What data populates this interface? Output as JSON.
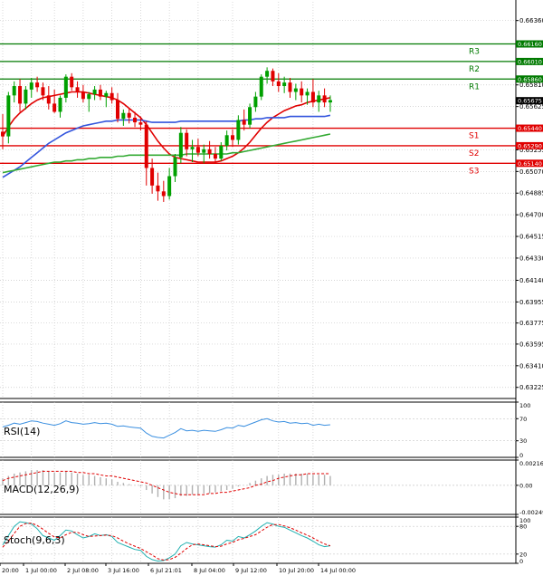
{
  "chart_data": {
    "type": "candlestick",
    "price_axis": {
      "range": [
        0.6313,
        0.6652
      ],
      "tick_values": [
        0.6636,
        0.6581,
        0.65625,
        0.65255,
        0.6507,
        0.64885,
        0.647,
        0.64515,
        0.6433,
        0.6414,
        0.63955,
        0.63775,
        0.63595,
        0.6341,
        0.63225
      ],
      "tick_labels": [
        "0.66360",
        "0.65810",
        "0.65625",
        "0.65255",
        "0.65070",
        "0.64885",
        "0.64700",
        "0.64515",
        "0.64330",
        "0.64140",
        "0.63955",
        "0.63775",
        "0.63595",
        "0.63410",
        "0.63225"
      ],
      "current_price": 0.65675,
      "current_price_label": "0.65675"
    },
    "levels": [
      {
        "name": "R3",
        "value": 0.6616,
        "label": "0.66160",
        "color": "#007a00"
      },
      {
        "name": "R2",
        "value": 0.6601,
        "label": "0.66010",
        "color": "#007a00"
      },
      {
        "name": "R1",
        "value": 0.6586,
        "label": "0.65860",
        "color": "#007a00"
      },
      {
        "name": "S1",
        "value": 0.6544,
        "label": "0.65440",
        "color": "#e00000"
      },
      {
        "name": "S2",
        "value": 0.6529,
        "label": "0.65290",
        "color": "#e00000"
      },
      {
        "name": "S3",
        "value": 0.6514,
        "label": "0.65140",
        "color": "#e00000"
      }
    ],
    "candles": [
      {
        "o": 0.6541,
        "h": 0.6556,
        "l": 0.6526,
        "c": 0.6537
      },
      {
        "o": 0.6537,
        "h": 0.6575,
        "l": 0.6531,
        "c": 0.6572
      },
      {
        "o": 0.6572,
        "h": 0.6584,
        "l": 0.6566,
        "c": 0.658
      },
      {
        "o": 0.658,
        "h": 0.6586,
        "l": 0.6558,
        "c": 0.6565
      },
      {
        "o": 0.6565,
        "h": 0.658,
        "l": 0.656,
        "c": 0.6577
      },
      {
        "o": 0.6577,
        "h": 0.6587,
        "l": 0.657,
        "c": 0.6583
      },
      {
        "o": 0.6583,
        "h": 0.6588,
        "l": 0.6575,
        "c": 0.6579
      },
      {
        "o": 0.6579,
        "h": 0.6583,
        "l": 0.6568,
        "c": 0.6572
      },
      {
        "o": 0.6572,
        "h": 0.658,
        "l": 0.656,
        "c": 0.6565
      },
      {
        "o": 0.6565,
        "h": 0.6577,
        "l": 0.6557,
        "c": 0.6558
      },
      {
        "o": 0.6558,
        "h": 0.6572,
        "l": 0.6553,
        "c": 0.657
      },
      {
        "o": 0.657,
        "h": 0.659,
        "l": 0.6566,
        "c": 0.6588
      },
      {
        "o": 0.6588,
        "h": 0.6591,
        "l": 0.6576,
        "c": 0.6579
      },
      {
        "o": 0.6579,
        "h": 0.6584,
        "l": 0.657,
        "c": 0.6575
      },
      {
        "o": 0.6575,
        "h": 0.6581,
        "l": 0.6566,
        "c": 0.6569
      },
      {
        "o": 0.6569,
        "h": 0.6575,
        "l": 0.6558,
        "c": 0.6573
      },
      {
        "o": 0.6573,
        "h": 0.658,
        "l": 0.6568,
        "c": 0.6577
      },
      {
        "o": 0.6577,
        "h": 0.6581,
        "l": 0.6568,
        "c": 0.6571
      },
      {
        "o": 0.6571,
        "h": 0.6576,
        "l": 0.6562,
        "c": 0.6574
      },
      {
        "o": 0.6574,
        "h": 0.6579,
        "l": 0.6565,
        "c": 0.6568
      },
      {
        "o": 0.6568,
        "h": 0.6574,
        "l": 0.6549,
        "c": 0.6552
      },
      {
        "o": 0.6552,
        "h": 0.656,
        "l": 0.6546,
        "c": 0.6557
      },
      {
        "o": 0.6557,
        "h": 0.6561,
        "l": 0.6548,
        "c": 0.6553
      },
      {
        "o": 0.6553,
        "h": 0.6558,
        "l": 0.6545,
        "c": 0.6549
      },
      {
        "o": 0.6549,
        "h": 0.6554,
        "l": 0.6542,
        "c": 0.6547
      },
      {
        "o": 0.6547,
        "h": 0.655,
        "l": 0.6495,
        "c": 0.651
      },
      {
        "o": 0.651,
        "h": 0.6518,
        "l": 0.6488,
        "c": 0.6495
      },
      {
        "o": 0.6495,
        "h": 0.6506,
        "l": 0.6482,
        "c": 0.649
      },
      {
        "o": 0.649,
        "h": 0.6499,
        "l": 0.6481,
        "c": 0.6486
      },
      {
        "o": 0.6486,
        "h": 0.651,
        "l": 0.6483,
        "c": 0.6503
      },
      {
        "o": 0.6503,
        "h": 0.6522,
        "l": 0.6498,
        "c": 0.6519
      },
      {
        "o": 0.6519,
        "h": 0.6545,
        "l": 0.6514,
        "c": 0.654
      },
      {
        "o": 0.654,
        "h": 0.6543,
        "l": 0.652,
        "c": 0.6526
      },
      {
        "o": 0.6526,
        "h": 0.6534,
        "l": 0.6515,
        "c": 0.6528
      },
      {
        "o": 0.6528,
        "h": 0.6535,
        "l": 0.652,
        "c": 0.6523
      },
      {
        "o": 0.6523,
        "h": 0.653,
        "l": 0.6514,
        "c": 0.6526
      },
      {
        "o": 0.6526,
        "h": 0.6533,
        "l": 0.6518,
        "c": 0.6522
      },
      {
        "o": 0.6522,
        "h": 0.6528,
        "l": 0.6514,
        "c": 0.6518
      },
      {
        "o": 0.6518,
        "h": 0.6532,
        "l": 0.6516,
        "c": 0.6529
      },
      {
        "o": 0.6529,
        "h": 0.6542,
        "l": 0.6525,
        "c": 0.6538
      },
      {
        "o": 0.6538,
        "h": 0.6543,
        "l": 0.6528,
        "c": 0.6534
      },
      {
        "o": 0.6534,
        "h": 0.6555,
        "l": 0.653,
        "c": 0.6551
      },
      {
        "o": 0.6551,
        "h": 0.656,
        "l": 0.6542,
        "c": 0.6547
      },
      {
        "o": 0.6547,
        "h": 0.6565,
        "l": 0.6544,
        "c": 0.6562
      },
      {
        "o": 0.6562,
        "h": 0.6575,
        "l": 0.6558,
        "c": 0.6571
      },
      {
        "o": 0.6571,
        "h": 0.659,
        "l": 0.6568,
        "c": 0.6588
      },
      {
        "o": 0.6588,
        "h": 0.6596,
        "l": 0.6582,
        "c": 0.6593
      },
      {
        "o": 0.6593,
        "h": 0.6595,
        "l": 0.658,
        "c": 0.6584
      },
      {
        "o": 0.6584,
        "h": 0.6591,
        "l": 0.6575,
        "c": 0.658
      },
      {
        "o": 0.658,
        "h": 0.6588,
        "l": 0.6574,
        "c": 0.6583
      },
      {
        "o": 0.6583,
        "h": 0.6587,
        "l": 0.657,
        "c": 0.6575
      },
      {
        "o": 0.6575,
        "h": 0.6582,
        "l": 0.6568,
        "c": 0.6578
      },
      {
        "o": 0.6578,
        "h": 0.6584,
        "l": 0.6566,
        "c": 0.6572
      },
      {
        "o": 0.6572,
        "h": 0.6578,
        "l": 0.6564,
        "c": 0.6575
      },
      {
        "o": 0.6575,
        "h": 0.6586,
        "l": 0.6562,
        "c": 0.6566
      },
      {
        "o": 0.6566,
        "h": 0.6576,
        "l": 0.6558,
        "c": 0.6572
      },
      {
        "o": 0.6572,
        "h": 0.6578,
        "l": 0.6562,
        "c": 0.6566
      },
      {
        "o": 0.6566,
        "h": 0.6572,
        "l": 0.6558,
        "c": 0.6568
      }
    ],
    "moving_averages": [
      {
        "id": "ma-red",
        "color": "#e00000",
        "values": [
          0.6537,
          0.6545,
          0.6552,
          0.6557,
          0.6561,
          0.6565,
          0.6568,
          0.657,
          0.6571,
          0.6572,
          0.6573,
          0.6574,
          0.6575,
          0.6575,
          0.6575,
          0.6574,
          0.6573,
          0.6572,
          0.6571,
          0.657,
          0.6568,
          0.6565,
          0.6561,
          0.6557,
          0.6553,
          0.6547,
          0.654,
          0.6533,
          0.6527,
          0.6522,
          0.6519,
          0.6518,
          0.6517,
          0.6516,
          0.6515,
          0.6515,
          0.6515,
          0.6515,
          0.6516,
          0.6518,
          0.652,
          0.6523,
          0.6527,
          0.6532,
          0.6538,
          0.6544,
          0.6549,
          0.6553,
          0.6556,
          0.6559,
          0.6561,
          0.6563,
          0.6564,
          0.6566,
          0.6567,
          0.6568,
          0.6569,
          0.657
        ]
      },
      {
        "id": "ma-blue",
        "color": "#3355dd",
        "values": [
          0.6502,
          0.6505,
          0.6508,
          0.6511,
          0.6515,
          0.6519,
          0.6523,
          0.6527,
          0.6531,
          0.6534,
          0.6537,
          0.654,
          0.6542,
          0.6544,
          0.6546,
          0.6547,
          0.6548,
          0.6549,
          0.655,
          0.655,
          0.6551,
          0.6551,
          0.6551,
          0.6551,
          0.6551,
          0.655,
          0.6549,
          0.6549,
          0.6549,
          0.6549,
          0.6549,
          0.655,
          0.655,
          0.655,
          0.655,
          0.655,
          0.655,
          0.655,
          0.655,
          0.655,
          0.655,
          0.655,
          0.6551,
          0.6551,
          0.6552,
          0.6552,
          0.6553,
          0.6553,
          0.6553,
          0.6553,
          0.6554,
          0.6554,
          0.6554,
          0.6554,
          0.6554,
          0.6554,
          0.6554,
          0.6555
        ]
      },
      {
        "id": "ma-green",
        "color": "#33aa33",
        "values": [
          0.6506,
          0.6507,
          0.6508,
          0.6509,
          0.651,
          0.6511,
          0.6512,
          0.6513,
          0.6514,
          0.6515,
          0.6515,
          0.6516,
          0.6516,
          0.6517,
          0.6517,
          0.6518,
          0.6518,
          0.6519,
          0.6519,
          0.6519,
          0.652,
          0.652,
          0.6521,
          0.6521,
          0.6521,
          0.6521,
          0.6521,
          0.6521,
          0.6521,
          0.6521,
          0.6521,
          0.6521,
          0.6522,
          0.6522,
          0.6522,
          0.6522,
          0.6522,
          0.6522,
          0.6522,
          0.6522,
          0.6523,
          0.6523,
          0.6524,
          0.6525,
          0.6526,
          0.6527,
          0.6528,
          0.6529,
          0.653,
          0.6531,
          0.6532,
          0.6533,
          0.6534,
          0.6535,
          0.6536,
          0.6537,
          0.6538,
          0.6539
        ]
      }
    ],
    "x_axis": {
      "labels": [
        "20:00",
        "1 Jul 00:00",
        "2 Jul 08:00",
        "3 Jul 16:00",
        "6 Jul 21:01",
        "8 Jul 04:00",
        "9 Jul 12:00",
        "10 Jul 20:00",
        "14 Jul 00:00"
      ],
      "label_bar_index": [
        0,
        5,
        9,
        14,
        19,
        24,
        29,
        34,
        40,
        48,
        54
      ]
    },
    "rsi": {
      "title": "RSI(14)",
      "range": [
        0,
        100
      ],
      "ticks": [
        100,
        70,
        30,
        0
      ],
      "tick_labels": [
        "100",
        "70",
        "30",
        "0"
      ],
      "values": [
        55,
        58,
        62,
        60,
        63,
        66,
        65,
        62,
        60,
        58,
        61,
        66,
        63,
        62,
        60,
        61,
        63,
        61,
        62,
        60,
        56,
        57,
        55,
        54,
        53,
        44,
        38,
        36,
        35,
        40,
        45,
        52,
        48,
        49,
        47,
        49,
        48,
        47,
        50,
        54,
        53,
        58,
        56,
        60,
        64,
        68,
        70,
        66,
        64,
        65,
        62,
        63,
        61,
        62,
        58,
        60,
        58,
        59
      ]
    },
    "macd": {
      "title": "MACD(12,26,9)",
      "range": [
        -0.00249,
        0.00216
      ],
      "ticks": [
        0.00216,
        0,
        -0.00249
      ],
      "tick_labels": [
        "0.00216",
        "0.00",
        "-0.00249"
      ],
      "histogram": [
        0.0006,
        0.0008,
        0.001,
        0.0011,
        0.0012,
        0.0013,
        0.0013,
        0.0013,
        0.0012,
        0.0011,
        0.0011,
        0.0012,
        0.0011,
        0.001,
        0.0009,
        0.0009,
        0.0008,
        0.0007,
        0.0006,
        0.0005,
        0.0003,
        0.0002,
        0.0001,
        0.0,
        -0.0001,
        -0.0004,
        -0.0007,
        -0.001,
        -0.0012,
        -0.0012,
        -0.0011,
        -0.0009,
        -0.0009,
        -0.0008,
        -0.0008,
        -0.0007,
        -0.0007,
        -0.0006,
        -0.0005,
        -0.0004,
        -0.0003,
        -0.0001,
        0.0,
        0.0002,
        0.0004,
        0.0006,
        0.0008,
        0.0009,
        0.0009,
        0.001,
        0.001,
        0.001,
        0.001,
        0.001,
        0.0009,
        0.0009,
        0.0009,
        0.0008
      ],
      "signal": [
        0.0004,
        0.0006,
        0.0007,
        0.0008,
        0.0009,
        0.001,
        0.0011,
        0.0012,
        0.0012,
        0.0012,
        0.0012,
        0.0012,
        0.0012,
        0.0011,
        0.0011,
        0.001,
        0.001,
        0.0009,
        0.0008,
        0.0008,
        0.0007,
        0.0006,
        0.0005,
        0.0004,
        0.0003,
        0.0002,
        0.0,
        -0.0002,
        -0.0004,
        -0.0006,
        -0.0007,
        -0.0008,
        -0.0008,
        -0.0008,
        -0.0008,
        -0.0008,
        -0.0007,
        -0.0007,
        -0.0006,
        -0.0006,
        -0.0005,
        -0.0004,
        -0.0003,
        -0.0002,
        0.0,
        0.0001,
        0.0003,
        0.0004,
        0.0006,
        0.0007,
        0.0008,
        0.0009,
        0.0009,
        0.001,
        0.001,
        0.001,
        0.001,
        0.001
      ]
    },
    "stoch": {
      "title": "Stoch(9,6,3)",
      "range": [
        0,
        100
      ],
      "ticks": [
        100,
        80,
        20,
        0
      ],
      "tick_labels": [
        "100",
        "80",
        "20",
        "0"
      ],
      "main": [
        40,
        60,
        80,
        90,
        88,
        85,
        75,
        60,
        55,
        50,
        60,
        72,
        70,
        62,
        55,
        58,
        64,
        60,
        62,
        58,
        45,
        40,
        35,
        30,
        28,
        15,
        8,
        5,
        6,
        12,
        20,
        38,
        45,
        42,
        40,
        38,
        36,
        35,
        40,
        50,
        48,
        58,
        55,
        62,
        70,
        80,
        88,
        85,
        80,
        78,
        72,
        66,
        60,
        55,
        48,
        40,
        36,
        38
      ],
      "signal": [
        35,
        48,
        65,
        80,
        86,
        87,
        82,
        74,
        65,
        57,
        55,
        62,
        67,
        67,
        62,
        58,
        59,
        60,
        61,
        60,
        55,
        48,
        42,
        37,
        32,
        25,
        18,
        10,
        7,
        8,
        13,
        22,
        32,
        40,
        42,
        40,
        38,
        36,
        37,
        42,
        45,
        51,
        54,
        58,
        62,
        70,
        78,
        84,
        84,
        81,
        77,
        72,
        66,
        61,
        55,
        48,
        42,
        38
      ]
    }
  }
}
